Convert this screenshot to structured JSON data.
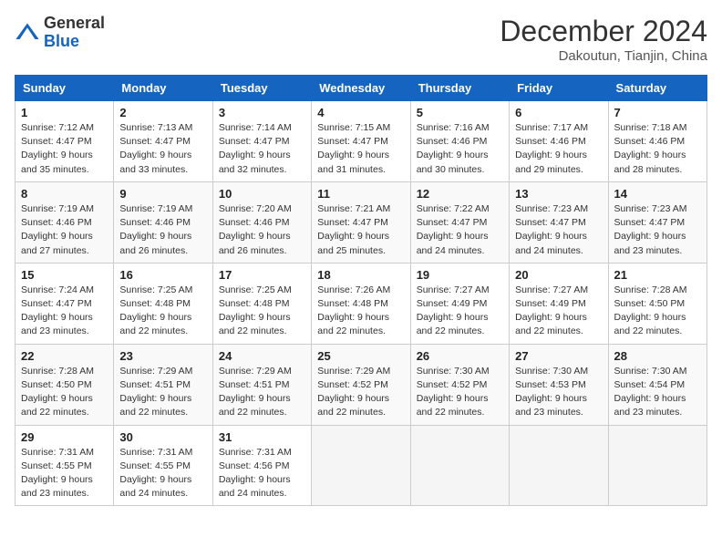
{
  "header": {
    "logo_general": "General",
    "logo_blue": "Blue",
    "month_title": "December 2024",
    "location": "Dakoutun, Tianjin, China"
  },
  "days_of_week": [
    "Sunday",
    "Monday",
    "Tuesday",
    "Wednesday",
    "Thursday",
    "Friday",
    "Saturday"
  ],
  "weeks": [
    [
      {
        "day": "1",
        "sunrise": "7:12 AM",
        "sunset": "4:47 PM",
        "daylight": "9 hours and 35 minutes."
      },
      {
        "day": "2",
        "sunrise": "7:13 AM",
        "sunset": "4:47 PM",
        "daylight": "9 hours and 33 minutes."
      },
      {
        "day": "3",
        "sunrise": "7:14 AM",
        "sunset": "4:47 PM",
        "daylight": "9 hours and 32 minutes."
      },
      {
        "day": "4",
        "sunrise": "7:15 AM",
        "sunset": "4:47 PM",
        "daylight": "9 hours and 31 minutes."
      },
      {
        "day": "5",
        "sunrise": "7:16 AM",
        "sunset": "4:46 PM",
        "daylight": "9 hours and 30 minutes."
      },
      {
        "day": "6",
        "sunrise": "7:17 AM",
        "sunset": "4:46 PM",
        "daylight": "9 hours and 29 minutes."
      },
      {
        "day": "7",
        "sunrise": "7:18 AM",
        "sunset": "4:46 PM",
        "daylight": "9 hours and 28 minutes."
      }
    ],
    [
      {
        "day": "8",
        "sunrise": "7:19 AM",
        "sunset": "4:46 PM",
        "daylight": "9 hours and 27 minutes."
      },
      {
        "day": "9",
        "sunrise": "7:19 AM",
        "sunset": "4:46 PM",
        "daylight": "9 hours and 26 minutes."
      },
      {
        "day": "10",
        "sunrise": "7:20 AM",
        "sunset": "4:46 PM",
        "daylight": "9 hours and 26 minutes."
      },
      {
        "day": "11",
        "sunrise": "7:21 AM",
        "sunset": "4:47 PM",
        "daylight": "9 hours and 25 minutes."
      },
      {
        "day": "12",
        "sunrise": "7:22 AM",
        "sunset": "4:47 PM",
        "daylight": "9 hours and 24 minutes."
      },
      {
        "day": "13",
        "sunrise": "7:23 AM",
        "sunset": "4:47 PM",
        "daylight": "9 hours and 24 minutes."
      },
      {
        "day": "14",
        "sunrise": "7:23 AM",
        "sunset": "4:47 PM",
        "daylight": "9 hours and 23 minutes."
      }
    ],
    [
      {
        "day": "15",
        "sunrise": "7:24 AM",
        "sunset": "4:47 PM",
        "daylight": "9 hours and 23 minutes."
      },
      {
        "day": "16",
        "sunrise": "7:25 AM",
        "sunset": "4:48 PM",
        "daylight": "9 hours and 22 minutes."
      },
      {
        "day": "17",
        "sunrise": "7:25 AM",
        "sunset": "4:48 PM",
        "daylight": "9 hours and 22 minutes."
      },
      {
        "day": "18",
        "sunrise": "7:26 AM",
        "sunset": "4:48 PM",
        "daylight": "9 hours and 22 minutes."
      },
      {
        "day": "19",
        "sunrise": "7:27 AM",
        "sunset": "4:49 PM",
        "daylight": "9 hours and 22 minutes."
      },
      {
        "day": "20",
        "sunrise": "7:27 AM",
        "sunset": "4:49 PM",
        "daylight": "9 hours and 22 minutes."
      },
      {
        "day": "21",
        "sunrise": "7:28 AM",
        "sunset": "4:50 PM",
        "daylight": "9 hours and 22 minutes."
      }
    ],
    [
      {
        "day": "22",
        "sunrise": "7:28 AM",
        "sunset": "4:50 PM",
        "daylight": "9 hours and 22 minutes."
      },
      {
        "day": "23",
        "sunrise": "7:29 AM",
        "sunset": "4:51 PM",
        "daylight": "9 hours and 22 minutes."
      },
      {
        "day": "24",
        "sunrise": "7:29 AM",
        "sunset": "4:51 PM",
        "daylight": "9 hours and 22 minutes."
      },
      {
        "day": "25",
        "sunrise": "7:29 AM",
        "sunset": "4:52 PM",
        "daylight": "9 hours and 22 minutes."
      },
      {
        "day": "26",
        "sunrise": "7:30 AM",
        "sunset": "4:52 PM",
        "daylight": "9 hours and 22 minutes."
      },
      {
        "day": "27",
        "sunrise": "7:30 AM",
        "sunset": "4:53 PM",
        "daylight": "9 hours and 23 minutes."
      },
      {
        "day": "28",
        "sunrise": "7:30 AM",
        "sunset": "4:54 PM",
        "daylight": "9 hours and 23 minutes."
      }
    ],
    [
      {
        "day": "29",
        "sunrise": "7:31 AM",
        "sunset": "4:55 PM",
        "daylight": "9 hours and 23 minutes."
      },
      {
        "day": "30",
        "sunrise": "7:31 AM",
        "sunset": "4:55 PM",
        "daylight": "9 hours and 24 minutes."
      },
      {
        "day": "31",
        "sunrise": "7:31 AM",
        "sunset": "4:56 PM",
        "daylight": "9 hours and 24 minutes."
      },
      null,
      null,
      null,
      null
    ]
  ],
  "labels": {
    "sunrise": "Sunrise:",
    "sunset": "Sunset:",
    "daylight": "Daylight:"
  }
}
